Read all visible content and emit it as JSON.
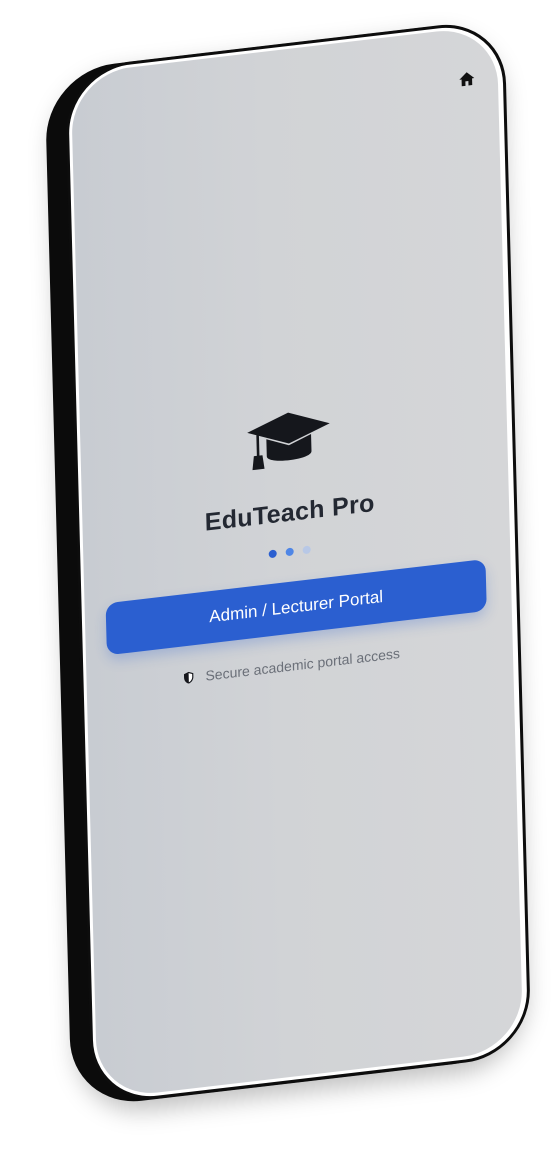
{
  "app": {
    "title": "EduTeach Pro"
  },
  "header": {
    "home_icon": "home-icon"
  },
  "logo": {
    "icon": "graduation-cap-icon"
  },
  "pagination": {
    "total": 3,
    "active_index": 1,
    "colors": [
      "#2b5fd0",
      "#4f86e6",
      "#b8c8e6"
    ]
  },
  "actions": {
    "portal_button_label": "Admin / Lecturer Portal"
  },
  "footer": {
    "secure_icon": "shield-icon",
    "secure_text": "Secure academic portal access"
  },
  "theme": {
    "accent": "#2b5fd0",
    "title_color": "#232832",
    "muted_text": "#6b7079"
  }
}
